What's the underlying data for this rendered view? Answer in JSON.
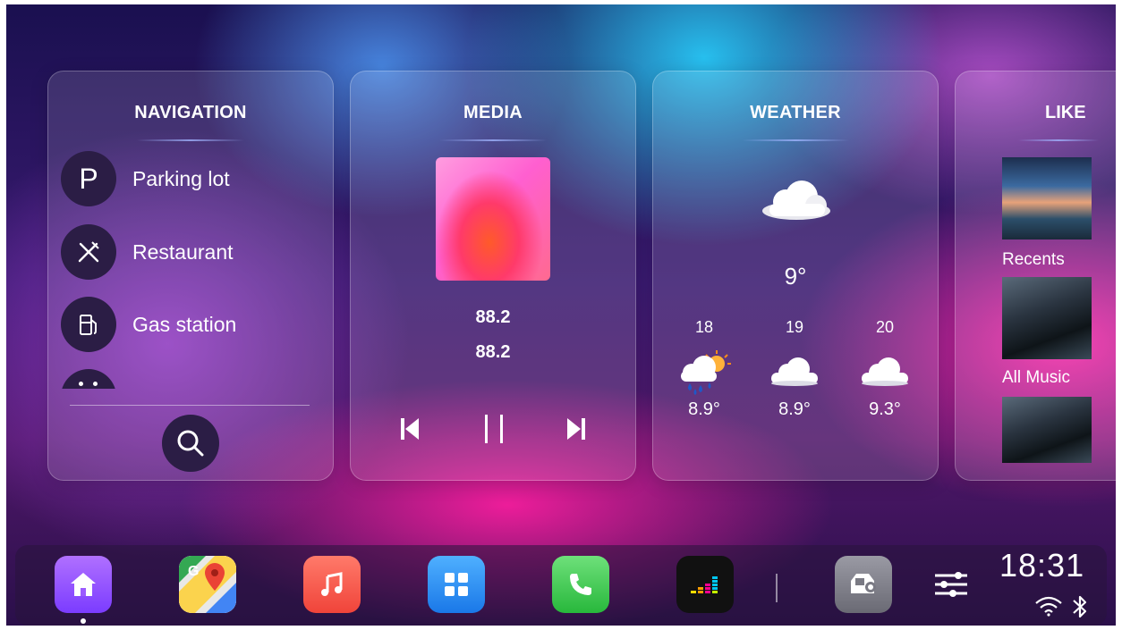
{
  "colors": {
    "accent": "#7b3cff",
    "card_bg": "rgba(255,255,255,0.13)",
    "dark_circle": "#2b1d45"
  },
  "navigation": {
    "title": "NAVIGATION",
    "items": [
      {
        "label": "Parking lot",
        "icon": "parking-icon",
        "glyph": "P"
      },
      {
        "label": "Restaurant",
        "icon": "restaurant-icon"
      },
      {
        "label": "Gas station",
        "icon": "gas-station-icon"
      }
    ],
    "search_icon": "search-icon"
  },
  "media": {
    "title": "MEDIA",
    "line1": "88.2",
    "line2": "88.2",
    "controls": [
      "previous-icon",
      "pause-icon",
      "next-icon"
    ]
  },
  "weather": {
    "title": "WEATHER",
    "current_temp": "9°",
    "current_icon": "cloud-icon",
    "forecast": [
      {
        "hour": "18",
        "temp": "8.9°",
        "icon": "rain-sun-icon"
      },
      {
        "hour": "19",
        "temp": "8.9°",
        "icon": "cloud-icon"
      },
      {
        "hour": "20",
        "temp": "9.3°",
        "icon": "cloud-icon"
      }
    ]
  },
  "likes": {
    "title": "LIKE",
    "items": [
      {
        "label": "Recents"
      },
      {
        "label": "All Music"
      }
    ]
  },
  "dock": {
    "apps": [
      "home-icon",
      "maps-icon",
      "music-icon",
      "apps-grid-icon",
      "phone-icon",
      "deezer-icon",
      "car-settings-icon",
      "equalizer-icon"
    ],
    "clock": "18:31",
    "status_icons": [
      "wifi-icon",
      "bluetooth-icon"
    ]
  }
}
